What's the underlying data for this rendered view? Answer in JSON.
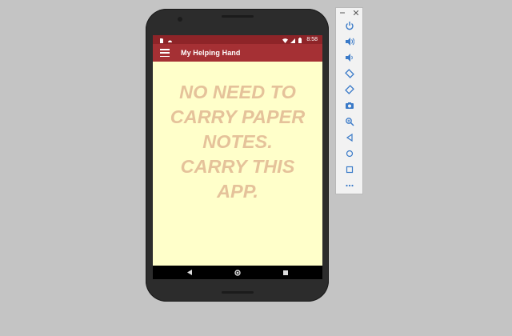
{
  "statusbar": {
    "time": "8:58"
  },
  "appbar": {
    "title": "My Helping Hand"
  },
  "content": {
    "message": "NO NEED TO\nCARRY PAPER\nNOTES.\nCARRY THIS\nAPP."
  },
  "colors": {
    "statusbar": "#8e2428",
    "appbar": "#a53034",
    "screen_background": "#ffffca",
    "message_text": "#e5c29a",
    "desktop_background": "#c4c4c4"
  },
  "emulator_toolbar": {
    "window_controls": [
      "minimize-icon",
      "close-icon"
    ],
    "buttons": [
      "power-icon",
      "volume-up-icon",
      "volume-down-icon",
      "rotate-left-icon",
      "rotate-right-icon",
      "camera-icon",
      "zoom-icon",
      "back-icon",
      "home-icon",
      "overview-icon",
      "more-icon"
    ]
  },
  "navbar": {
    "buttons": [
      "back-icon",
      "home-icon",
      "recents-icon"
    ]
  }
}
